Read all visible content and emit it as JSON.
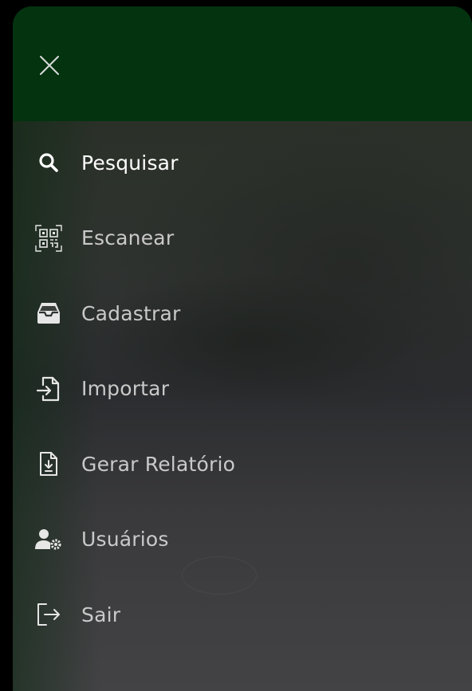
{
  "header": {
    "close_icon": "close-icon",
    "background_color": "#03330f"
  },
  "menu": {
    "items": [
      {
        "label": "Pesquisar",
        "icon": "search-icon",
        "active": true
      },
      {
        "label": "Escanear",
        "icon": "qr-code-icon",
        "active": false
      },
      {
        "label": "Cadastrar",
        "icon": "inbox-tray-icon",
        "active": false
      },
      {
        "label": "Importar",
        "icon": "file-import-icon",
        "active": false
      },
      {
        "label": "Gerar Relatório",
        "icon": "file-download-icon",
        "active": false
      },
      {
        "label": "Usuários",
        "icon": "users-gear-icon",
        "active": false
      },
      {
        "label": "Sair",
        "icon": "logout-icon",
        "active": false
      }
    ]
  },
  "colors": {
    "active_text": "#ffffff",
    "inactive_text": "#c9c9c9",
    "icon": "#e6e6e6"
  }
}
